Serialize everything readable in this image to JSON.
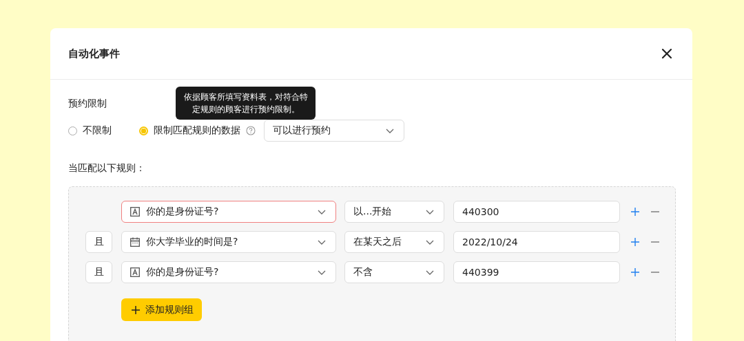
{
  "dialog": {
    "title": "自动化事件"
  },
  "restriction": {
    "label": "预约限制",
    "options": [
      {
        "label": "不限制",
        "selected": false,
        "help": false
      },
      {
        "label": "限制匹配规则的数据",
        "selected": true,
        "help": true
      }
    ],
    "tooltip": "依据顾客所填写资料表，对符合特定规则的顾客进行预约限制。",
    "action": {
      "value": "可以进行预约"
    }
  },
  "rules": {
    "label": "当匹配以下规则：",
    "rows": [
      {
        "connector": "",
        "field": {
          "kind": "text",
          "label": "你的是身份证号?"
        },
        "error": true,
        "operator": "以...开始",
        "value": "440300"
      },
      {
        "connector": "且",
        "field": {
          "kind": "date",
          "label": "你大学毕业的时间是?"
        },
        "error": false,
        "operator": "在某天之后",
        "value": "2022/10/24"
      },
      {
        "connector": "且",
        "field": {
          "kind": "text",
          "label": "你的是身份证号?"
        },
        "error": false,
        "operator": "不含",
        "value": "440399"
      }
    ],
    "add_button": "添加规则组"
  }
}
